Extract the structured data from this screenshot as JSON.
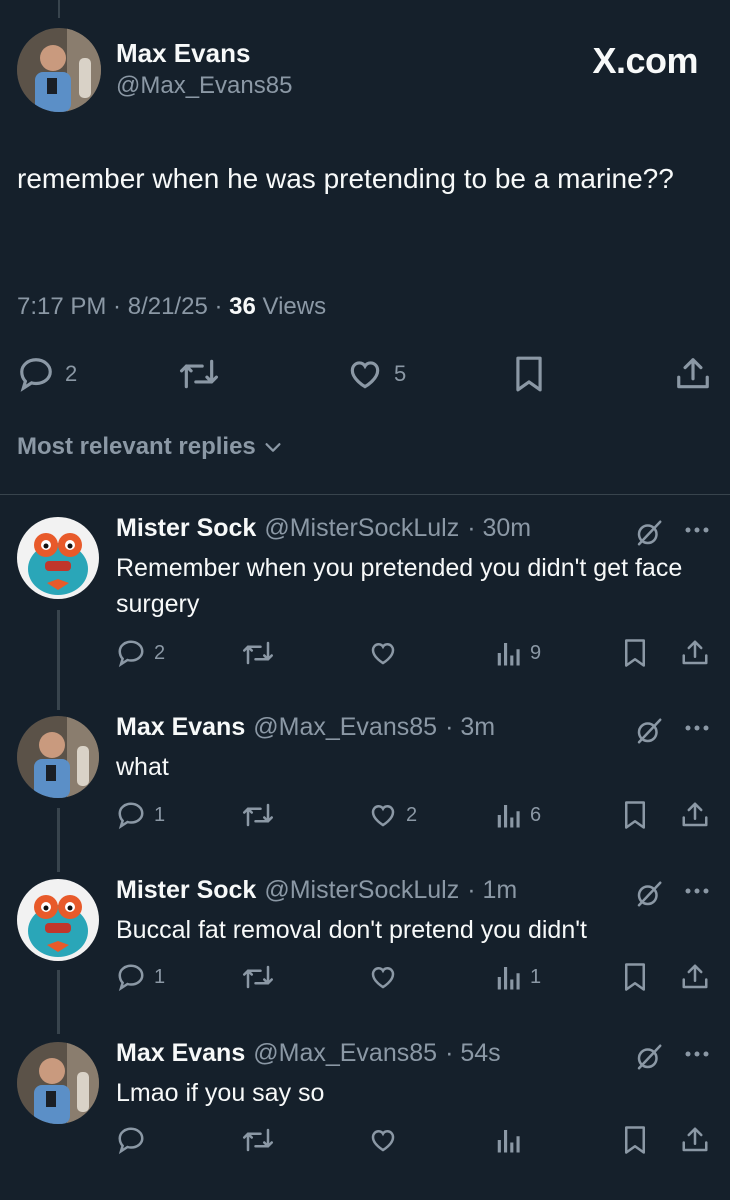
{
  "header": {
    "brand": "X.com"
  },
  "tweet": {
    "author_name": "Max Evans",
    "author_handle": "@Max_Evans85",
    "text": "remember when he was pretending to be a marine??",
    "time": "7:17 PM",
    "date": "8/21/25",
    "views_count": "36",
    "views_label": "Views",
    "replies": "2",
    "likes": "5"
  },
  "sort_label": "Most relevant replies",
  "replies": [
    {
      "name": "Mister Sock",
      "handle": "@MisterSockLulz",
      "age": "30m",
      "text": "Remember when you pretended you didn't get face surgery",
      "replies": "2",
      "reposts": "",
      "likes": "",
      "views": "9"
    },
    {
      "name": "Max Evans",
      "handle": "@Max_Evans85",
      "age": "3m",
      "text": "what",
      "replies": "1",
      "reposts": "",
      "likes": "2",
      "views": "6"
    },
    {
      "name": "Mister Sock",
      "handle": "@MisterSockLulz",
      "age": "1m",
      "text": "Buccal fat removal don't pretend you didn't",
      "replies": "1",
      "reposts": "",
      "likes": "",
      "views": "1"
    },
    {
      "name": "Max Evans",
      "handle": "@Max_Evans85",
      "age": "54s",
      "text": "Lmao if you say so",
      "replies": "",
      "reposts": "",
      "likes": "",
      "views": ""
    }
  ],
  "colors": {
    "background": "#15202b",
    "text": "#f7f9f9",
    "muted": "#8b98a5",
    "divider": "#38444d"
  },
  "icons": [
    "reply-icon",
    "repost-icon",
    "like-icon",
    "bookmark-icon",
    "share-icon",
    "views-icon",
    "grok-icon",
    "more-icon",
    "chevron-down-icon"
  ]
}
